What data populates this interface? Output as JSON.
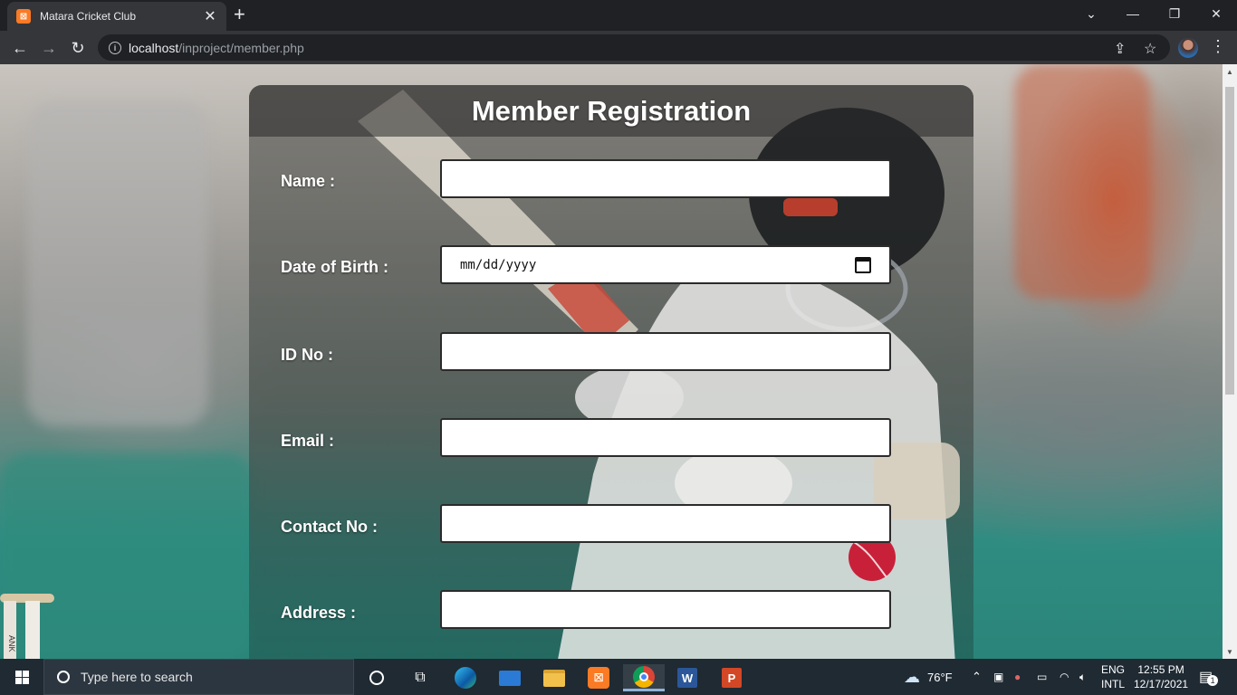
{
  "browser": {
    "tab_title": "Matara Cricket Club",
    "tab_close": "✕",
    "new_tab": "+",
    "url_host": "localhost",
    "url_path": "/inproject/member.php",
    "icons": [
      "back-arrow-icon",
      "forward-arrow-icon",
      "reload-icon",
      "info-icon",
      "share-icon",
      "star-icon",
      "avatar",
      "kebab-menu-icon"
    ]
  },
  "form": {
    "title": "Member Registration",
    "fields": [
      {
        "label": "Name :",
        "value": ""
      },
      {
        "label": "Date of Birth :",
        "value": "mm/dd/yyyy"
      },
      {
        "label": "ID No :",
        "value": ""
      },
      {
        "label": "Email :",
        "value": ""
      },
      {
        "label": "Contact No :",
        "value": ""
      },
      {
        "label": "Address :",
        "value": ""
      }
    ]
  },
  "taskbar": {
    "search_placeholder": "Type here to search",
    "weather": "76°F",
    "language": "ENG",
    "layout": "INTL",
    "time": "12:55 PM",
    "date": "12/17/2021",
    "notification_count": "1"
  },
  "colors": {
    "chrome_dark": "#202124",
    "chrome_toolbar": "#35363a",
    "taskbar": "#1f2a33",
    "card_header": "#3a3a3a",
    "accent_orange": "#fb7a24"
  }
}
